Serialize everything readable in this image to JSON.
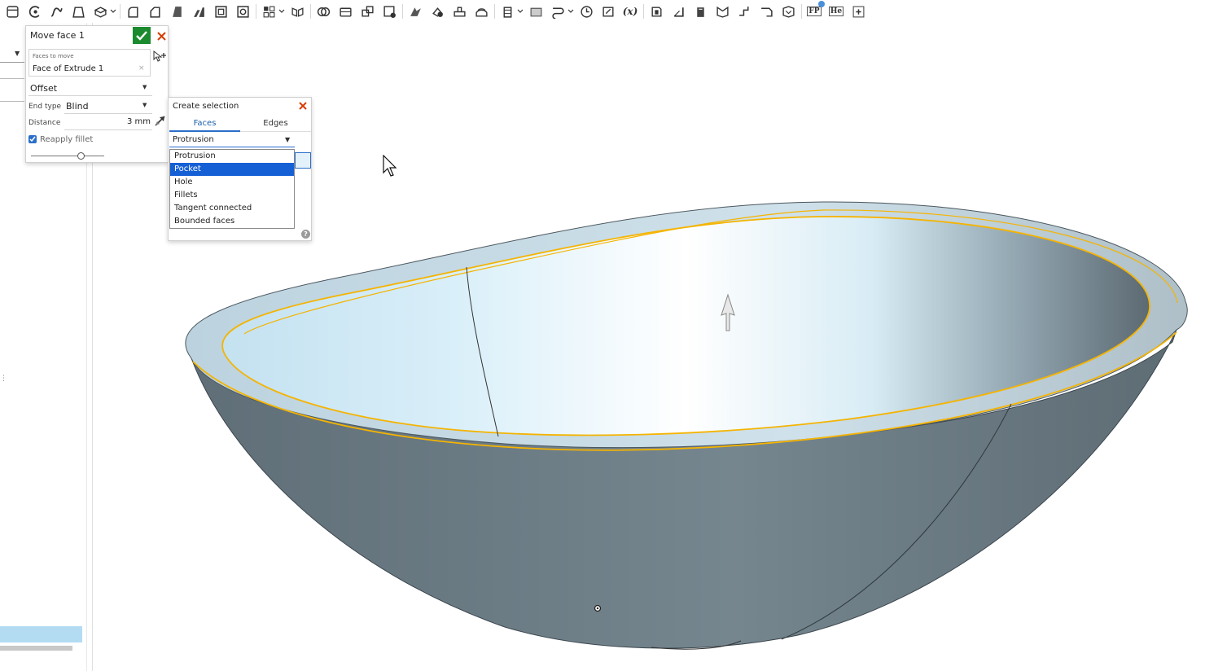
{
  "toolbar": {
    "icons": [
      "new-sketch-icon",
      "revolve-icon",
      "sweep-icon",
      "loft-icon",
      "thicken-icon",
      "fillet-icon",
      "chamfer-icon",
      "draft-icon",
      "rib-icon",
      "shell-icon",
      "hole-icon",
      "pattern-icon",
      "mirror-icon",
      "boolean-icon",
      "split-icon",
      "transform-icon",
      "delete-part-icon",
      "modify-fillet-icon",
      "move-face-icon",
      "replace-face-icon",
      "offset-surface-icon",
      "helix-icon",
      "plane-icon",
      "mate-connector-icon",
      "section-icon",
      "measure-icon",
      "variable-icon",
      "sheet-metal-icon",
      "flange-icon",
      "hem-icon",
      "tab-icon",
      "bend-icon",
      "form-icon",
      "corner-icon",
      "finish-icon",
      "custom-feature-icon",
      "feature-studio-icon",
      "add-feature-icon"
    ],
    "variable_label": "(x)",
    "fp_label": "FP",
    "he_label": "He"
  },
  "move_face": {
    "title": "Move face 1",
    "faces_label": "Faces to move",
    "faces_value": "Face of Extrude 1",
    "clear_glyph": "×",
    "move_type": "Offset",
    "end_type_label": "End type",
    "end_type_value": "Blind",
    "distance_label": "Distance",
    "distance_value": "3 mm",
    "reapply_fillet_label": "Reapply fillet",
    "reapply_fillet_checked": true
  },
  "create_selection": {
    "title": "Create selection",
    "tabs": [
      {
        "label": "Faces",
        "active": true
      },
      {
        "label": "Edges",
        "active": false
      }
    ],
    "selected_value": "Protrusion",
    "options": [
      "Protrusion",
      "Pocket",
      "Hole",
      "Fillets",
      "Tangent connected",
      "Bounded faces"
    ],
    "highlighted_option": "Pocket",
    "help_glyph": "?"
  },
  "colors": {
    "accept_green": "#1b8a2e",
    "cancel_red": "#d83b01",
    "selection_blue": "#1660d6",
    "highlight_edge": "#f5b400",
    "part_outer": "#66767f",
    "part_inner_light": "#e8f6fd"
  }
}
